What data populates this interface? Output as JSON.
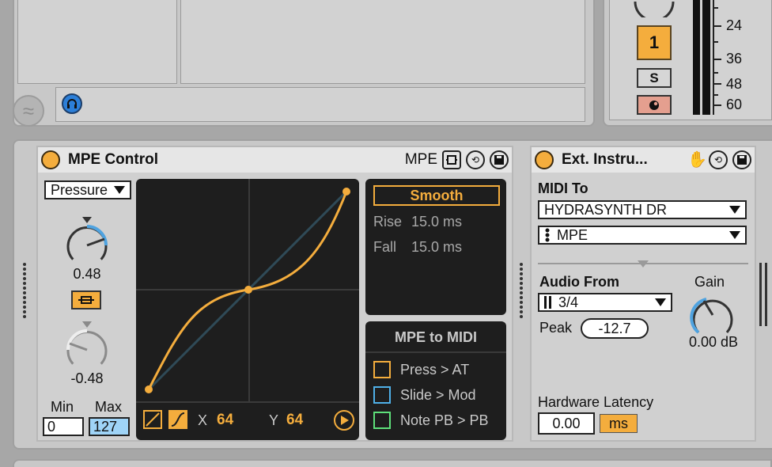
{
  "top": {
    "mixer": {
      "track_number": "1",
      "solo_label": "S",
      "db_labels": [
        "24",
        "36",
        "48",
        "60"
      ]
    }
  },
  "mpe_control": {
    "title": "MPE Control",
    "mpe_label": "MPE",
    "source_select": "Pressure",
    "knob1_value": "0.48",
    "knob2_value": "-0.48",
    "min_label": "Min",
    "max_label": "Max",
    "min_value": "0",
    "max_value": "127",
    "curve": {
      "x_label": "X",
      "x_value": "64",
      "y_label": "Y",
      "y_value": "64"
    },
    "smooth": {
      "label": "Smooth",
      "rise_label": "Rise",
      "rise_value": "15.0 ms",
      "fall_label": "Fall",
      "fall_value": "15.0 ms"
    },
    "mpe_to_midi": {
      "title": "MPE to MIDI",
      "items": [
        {
          "label": "Press > AT",
          "color": "#f4ad3d"
        },
        {
          "label": "Slide > Mod",
          "color": "#4fb0e8"
        },
        {
          "label": "Note PB > PB",
          "color": "#5ee07a"
        }
      ]
    }
  },
  "ext_instrument": {
    "title": "Ext. Instru...",
    "midi_to_label": "MIDI To",
    "midi_to_value": "HYDRASYNTH DR",
    "midi_channel_value": "MPE",
    "audio_from_label": "Audio From",
    "audio_from_value": "3/4",
    "gain_label": "Gain",
    "gain_value": "0.00 dB",
    "peak_label": "Peak",
    "peak_value": "-12.7",
    "latency_label": "Hardware Latency",
    "latency_value": "0.00",
    "latency_unit": "ms"
  },
  "colors": {
    "accent": "#f4ad3d",
    "curve": "#f4ad3d",
    "diagonal": "#2f4a57",
    "selected_field": "#9fd4f7"
  }
}
